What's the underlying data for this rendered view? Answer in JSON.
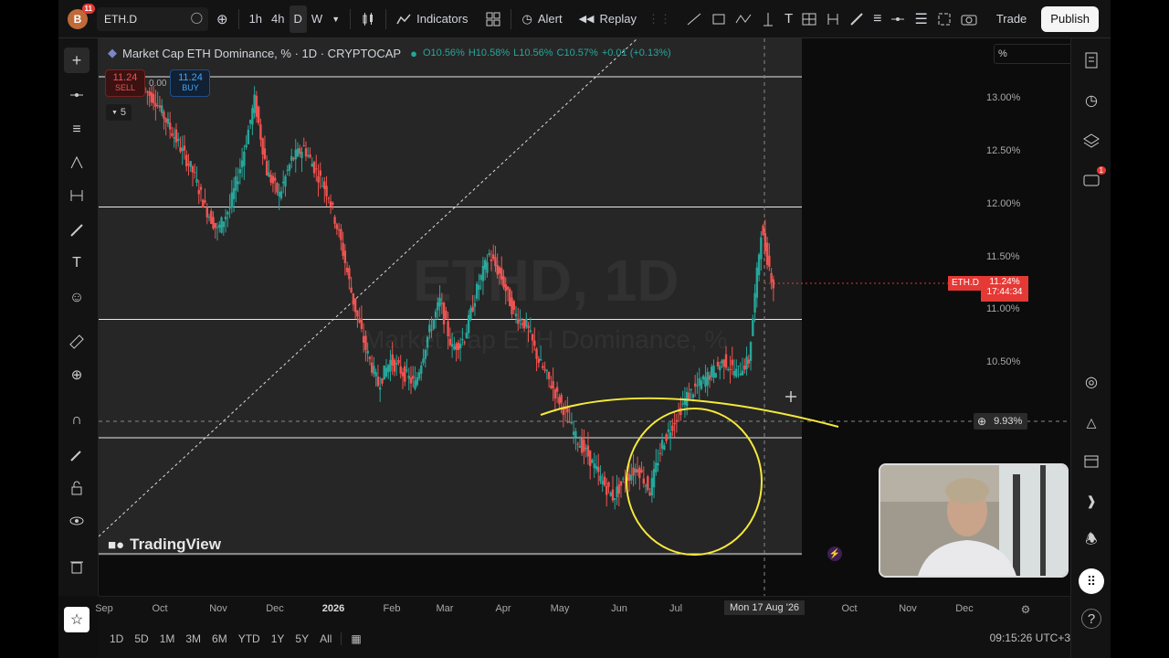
{
  "toolbar": {
    "avatar_letter": "B",
    "avatar_badge": "11",
    "symbol": "ETH.D",
    "intervals": [
      "1h",
      "4h",
      "D",
      "W"
    ],
    "indicators_label": "Indicators",
    "alert_label": "Alert",
    "replay_label": "Replay",
    "trade_label": "Trade",
    "publish_label": "Publish"
  },
  "legend": {
    "title": "Market Cap ETH Dominance, % · 1D · CRYPTOCAP",
    "open": "O10.56%",
    "high": "H10.58%",
    "low": "L10.56%",
    "close": "C10.57%",
    "change": "+0.01 (+0.13%)"
  },
  "trade_panel": {
    "sell_price": "11.24",
    "sell_label": "SELL",
    "spread": "0.00",
    "buy_price": "11.24",
    "buy_label": "BUY",
    "indicator_count": "5"
  },
  "watermark": {
    "symbol": "ETHD, 1D",
    "name": "Market Cap ETH Dominance, %"
  },
  "y_axis": {
    "unit_box": "%",
    "labels": [
      "13.00%",
      "12.50%",
      "12.00%",
      "11.50%",
      "11.00%",
      "10.50%"
    ],
    "crosshair_value": "9.93%",
    "price_tag_symbol": "ETH.D",
    "price_tag_value": "11.24%",
    "price_tag_timer": "17:44:34"
  },
  "x_axis": {
    "labels": [
      "Sep",
      "Oct",
      "Nov",
      "Dec",
      "2026",
      "Feb",
      "Mar",
      "Apr",
      "May",
      "Jun",
      "Jul",
      "Mon 17 Aug '26",
      "Oct",
      "Nov",
      "Dec"
    ]
  },
  "bottom": {
    "ranges": [
      "1D",
      "5D",
      "1M",
      "3M",
      "6M",
      "YTD",
      "1Y",
      "5Y",
      "All"
    ],
    "clock": "09:15:26 UTC+3"
  },
  "brand": "TradingView",
  "chat_badge": "1",
  "chart_data": {
    "type": "candlestick",
    "series_values": [
      12.9,
      12.8,
      12.6,
      12.4,
      12.2,
      11.9,
      11.7,
      11.9,
      12.3,
      12.8,
      12.2,
      12.0,
      12.3,
      12.4,
      12.2,
      12.0,
      11.6,
      11.1,
      10.7,
      10.4,
      10.6,
      10.5,
      10.4,
      10.8,
      11.1,
      10.7,
      10.8,
      11.2,
      11.5,
      11.3,
      11.0,
      10.9,
      10.6,
      10.4,
      10.2,
      9.95,
      9.8,
      9.6,
      9.45,
      9.6,
      9.7,
      9.5,
      9.9,
      10.1,
      10.3,
      10.4,
      10.5,
      10.6,
      10.5,
      10.6,
      11.7,
      11.24
    ],
    "y_range": [
      9.0,
      13.0
    ],
    "horizontal_levels": [
      13.0,
      11.9,
      10.95,
      9.95
    ]
  }
}
